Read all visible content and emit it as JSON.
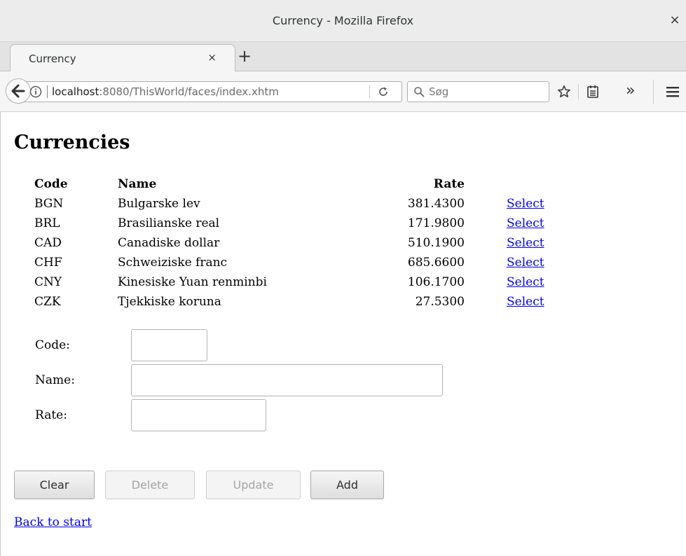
{
  "window": {
    "title": "Currency - Mozilla Firefox",
    "close_glyph": "×"
  },
  "tabs": [
    {
      "label": "Currency",
      "close_glyph": "×"
    }
  ],
  "newtab_glyph": "+",
  "navbar": {
    "url_host": "localhost",
    "url_rest": ":8080/ThisWorld/faces/index.xhtm",
    "search_placeholder": "Søg",
    "overflow_glyph": "»"
  },
  "page": {
    "title": "Currencies",
    "table": {
      "headers": {
        "code": "Code",
        "name": "Name",
        "rate": "Rate"
      },
      "rows": [
        {
          "code": "BGN",
          "name": "Bulgarske lev",
          "rate": "381.4300",
          "action": "Select"
        },
        {
          "code": "BRL",
          "name": "Brasilianske real",
          "rate": "171.9800",
          "action": "Select"
        },
        {
          "code": "CAD",
          "name": "Canadiske dollar",
          "rate": "510.1900",
          "action": "Select"
        },
        {
          "code": "CHF",
          "name": "Schweiziske franc",
          "rate": "685.6600",
          "action": "Select"
        },
        {
          "code": "CNY",
          "name": "Kinesiske Yuan renminbi",
          "rate": "106.1700",
          "action": "Select"
        },
        {
          "code": "CZK",
          "name": "Tjekkiske koruna",
          "rate": "27.5300",
          "action": "Select"
        }
      ]
    },
    "form": {
      "code_label": "Code:",
      "code_value": "",
      "name_label": "Name:",
      "name_value": "",
      "rate_label": "Rate:",
      "rate_value": ""
    },
    "buttons": {
      "clear": "Clear",
      "delete": "Delete",
      "update": "Update",
      "add": "Add"
    },
    "back_link": "Back to start"
  },
  "icons": {
    "back": "back-arrow-icon",
    "info": "info-icon",
    "reload": "reload-icon",
    "search": "search-icon",
    "star": "bookmark-star-icon",
    "reader": "reader-view-icon",
    "menu": "hamburger-menu-icon"
  },
  "colors": {
    "link": "#0000ee",
    "chrome": "#ececec"
  }
}
